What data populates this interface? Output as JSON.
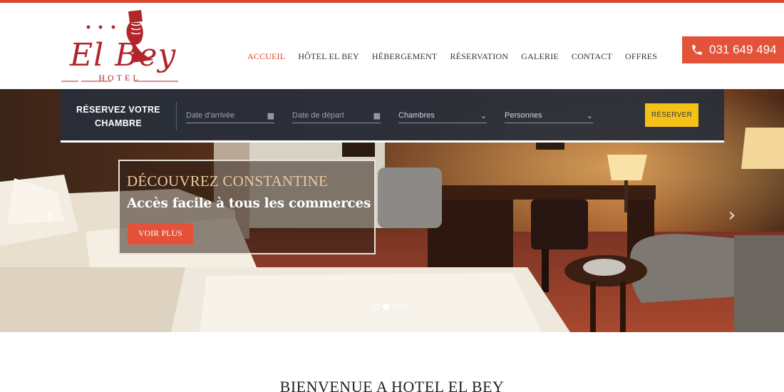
{
  "brand": {
    "script": "El Bey",
    "word": "HOTEL",
    "stars": "★ ★ ★"
  },
  "nav": [
    {
      "label": "ACCUEIL",
      "active": true
    },
    {
      "label": "HÔTEL EL BEY",
      "active": false
    },
    {
      "label": "HÉBERGEMENT",
      "active": false
    },
    {
      "label": "RÉSERVATION",
      "active": false
    },
    {
      "label": "GALERIE",
      "active": false
    },
    {
      "label": "CONTACT",
      "active": false
    },
    {
      "label": "OFFRES",
      "active": false
    }
  ],
  "phone": {
    "number": "031 649 494",
    "icon": "phone-icon"
  },
  "booking": {
    "title_line1": "RÉSERVEZ VOTRE",
    "title_line2": "CHAMBRE",
    "arrival_placeholder": "Date d'arrivée",
    "departure_placeholder": "Date de départ",
    "rooms_value": "Chambres",
    "persons_value": "Personnes",
    "submit": "RÉSERVER"
  },
  "slide": {
    "heading": "DÉCOUVREZ CONSTANTINE",
    "subheading": "Accès facile à tous les commerces",
    "button": "VOIR PLUS",
    "active_index": 2,
    "count": 4
  },
  "welcome": {
    "title": "BIENVENUE A HOTEL EL BEY"
  },
  "colors": {
    "accent": "#e4523a",
    "top_bar": "#d9472b",
    "reserve": "#f4c217",
    "booking_bg": "#282e3a",
    "logo": "#b1262b"
  }
}
